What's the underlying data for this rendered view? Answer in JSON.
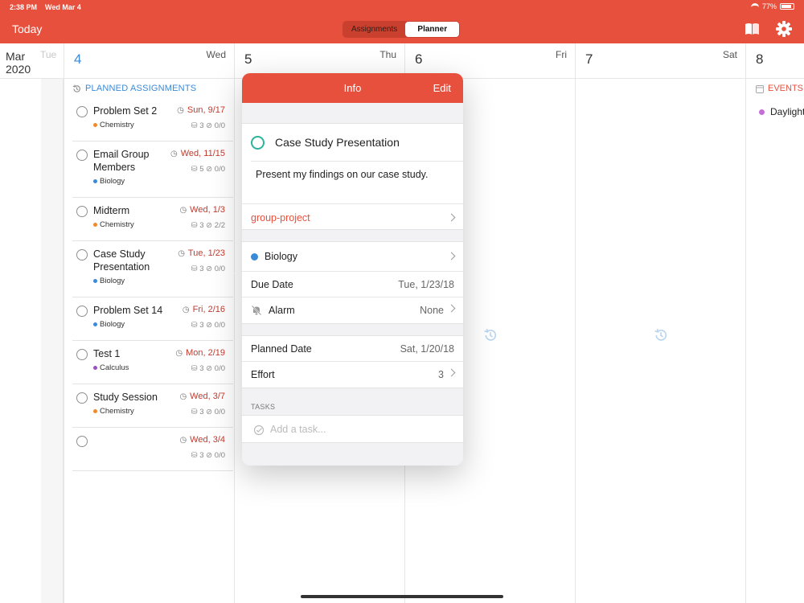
{
  "status": {
    "time": "2:38 PM",
    "date": "Wed Mar 4",
    "battery": "77%"
  },
  "header": {
    "today_label": "Today",
    "tabs": [
      {
        "label": "Assignments",
        "active": false
      },
      {
        "label": "Planner",
        "active": true
      }
    ],
    "accent_color": "#e8503e"
  },
  "calendar": {
    "month": "Mar",
    "year": "2020",
    "prev_day_ghost": "Tue",
    "days": [
      {
        "num": "4",
        "name": "Wed",
        "today": true
      },
      {
        "num": "5",
        "name": "Thu"
      },
      {
        "num": "6",
        "name": "Fri"
      },
      {
        "num": "7",
        "name": "Sat"
      },
      {
        "num": "8",
        "name": ""
      }
    ]
  },
  "planned": {
    "header": "PLANNED ASSIGNMENTS",
    "items": [
      {
        "title": "Problem Set 2",
        "course": "Chemistry",
        "course_color": "#f08a2c",
        "due": "Sun, 9/17",
        "effort": "3",
        "tasks": "0/0"
      },
      {
        "title": "Email Group Members",
        "course": "Biology",
        "course_color": "#3b8ad8",
        "due": "Wed, 11/15",
        "effort": "5",
        "tasks": "0/0"
      },
      {
        "title": "Midterm",
        "course": "Chemistry",
        "course_color": "#f08a2c",
        "due": "Wed, 1/3",
        "effort": "3",
        "tasks": "2/2"
      },
      {
        "title": "Case Study Presentation",
        "course": "Biology",
        "course_color": "#3b8ad8",
        "due": "Tue, 1/23",
        "effort": "3",
        "tasks": "0/0"
      },
      {
        "title": "Problem Set 14",
        "course": "Biology",
        "course_color": "#3b8ad8",
        "due": "Fri, 2/16",
        "effort": "3",
        "tasks": "0/0"
      },
      {
        "title": "Test 1",
        "course": "Calculus",
        "course_color": "#9b4fc4",
        "due": "Mon, 2/19",
        "effort": "3",
        "tasks": "0/0"
      },
      {
        "title": "Study Session",
        "course": "Chemistry",
        "course_color": "#f08a2c",
        "due": "Wed, 3/7",
        "effort": "3",
        "tasks": "0/0"
      },
      {
        "title": "",
        "course": "",
        "course_color": "",
        "due": "Wed, 3/4",
        "effort": "3",
        "tasks": "0/0"
      }
    ]
  },
  "events": {
    "header": "EVENTS",
    "items": [
      {
        "title": "Daylight",
        "color": "#c46fd8"
      }
    ]
  },
  "popover": {
    "title": "Info",
    "edit_label": "Edit",
    "assignment_title": "Case Study Presentation",
    "description": "Present my findings on our case study.",
    "tag": "group-project",
    "course": "Biology",
    "course_color": "#3b8ad8",
    "due_date_label": "Due Date",
    "due_date_value": "Tue, 1/23/18",
    "alarm_label": "Alarm",
    "alarm_value": "None",
    "planned_date_label": "Planned Date",
    "planned_date_value": "Sat, 1/20/18",
    "effort_label": "Effort",
    "effort_value": "3",
    "tasks_header": "TASKS",
    "add_task_placeholder": "Add a task..."
  }
}
